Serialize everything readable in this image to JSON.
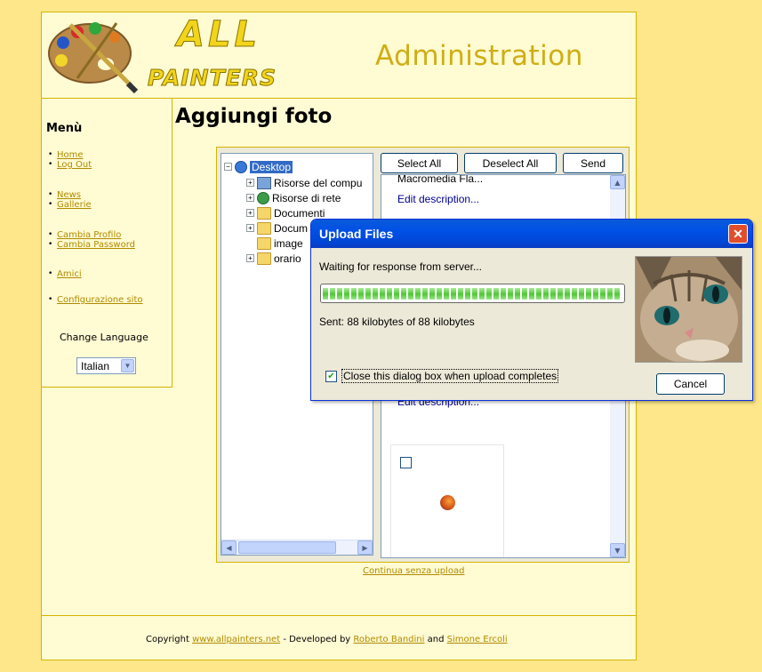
{
  "header": {
    "logo_text_top": "ALL",
    "logo_text_bottom": "PAINTERS",
    "admin_title": "Administration"
  },
  "sidebar": {
    "menu_title": "Menù",
    "groups": [
      [
        "Home",
        "Log Out"
      ],
      [
        "News",
        "Gallerie"
      ],
      [
        "Cambia Profilo",
        "Cambia Password"
      ],
      [
        "Amici"
      ],
      [
        "Configurazione sito"
      ]
    ],
    "change_language_label": "Change Language",
    "language_selected": "Italian"
  },
  "main": {
    "page_title": "Aggiungi foto",
    "tree": {
      "desktop": "Desktop",
      "items": [
        "Risorse del compu",
        "Risorse di rete",
        "Documenti",
        "Docum",
        "image",
        "orario"
      ]
    },
    "buttons": {
      "select_all": "Select All",
      "deselect_all": "Deselect All",
      "send": "Send"
    },
    "list": {
      "top_partial": "Macromedia Fla...",
      "edit_description": "Edit description...",
      "edit_description_partial": "Edit description..."
    },
    "continue_link": "Continua senza upload"
  },
  "dialog": {
    "title": "Upload Files",
    "waiting_text": "Waiting for response from server...",
    "progress_percent": 100,
    "sent_text": "Sent: 88 kilobytes of 88 kilobytes",
    "close_checkbox_label": "Close this dialog box when upload completes",
    "close_checked": true,
    "cancel_label": "Cancel"
  },
  "footer": {
    "copyright_prefix": "Copyright",
    "site_link": "www.allpainters.net",
    "developed_by": "- Developed by",
    "author1": "Roberto Bandini",
    "and_text": "and",
    "author2": "Simone Ercoli"
  },
  "colors": {
    "background": "#fde78a",
    "panel": "#fffbd3",
    "gold": "#cfae14",
    "xp_blue": "#0050e6"
  }
}
